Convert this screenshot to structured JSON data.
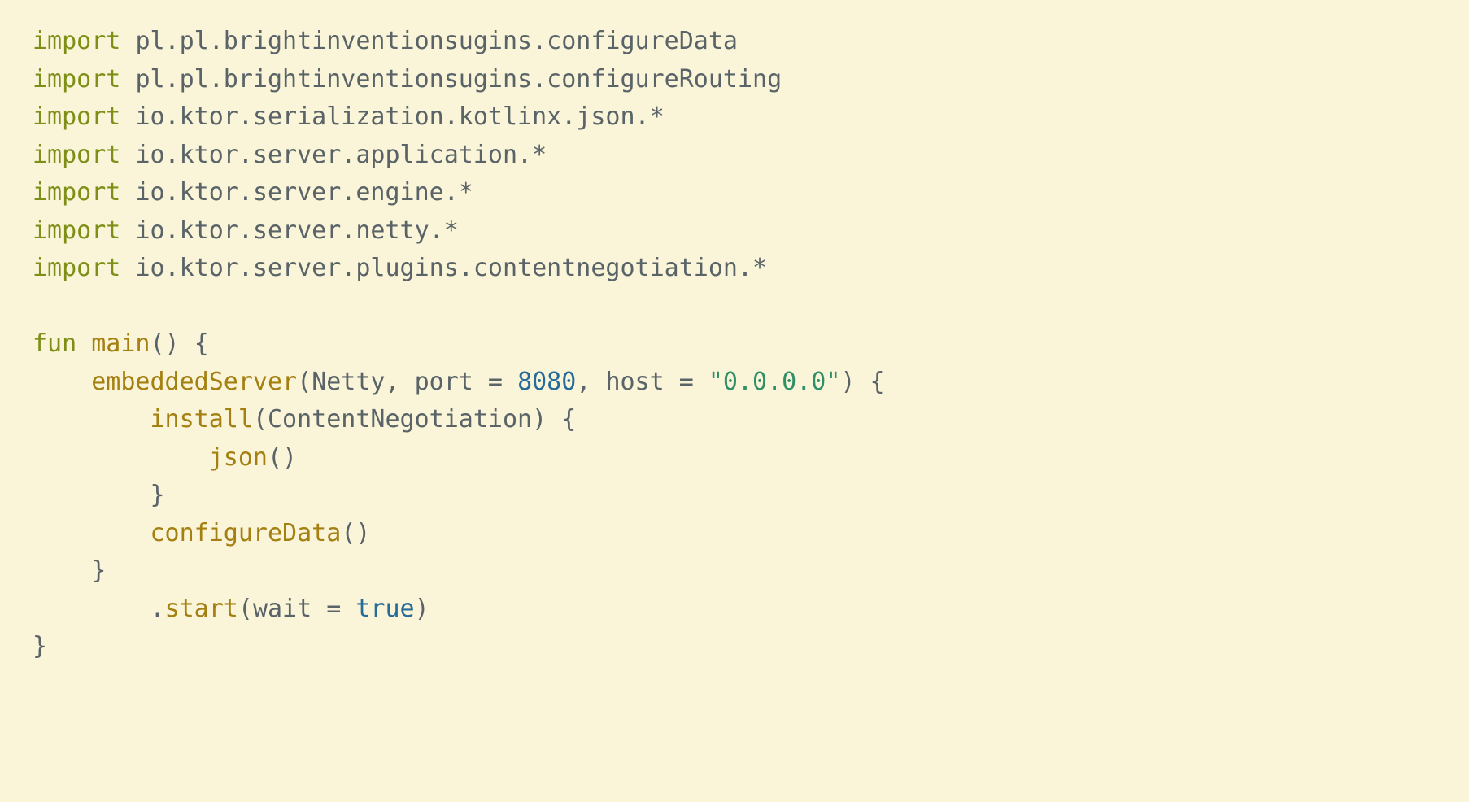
{
  "code": {
    "imports": [
      "pl.pl.brightinventionsugins.configureData",
      "pl.pl.brightinventionsugins.configureRouting",
      "io.ktor.serialization.kotlinx.json.*",
      "io.ktor.server.application.*",
      "io.ktor.server.engine.*",
      "io.ktor.server.netty.*",
      "io.ktor.server.plugins.contentnegotiation.*"
    ],
    "kw_import": "import",
    "kw_fun": "fun",
    "fn_name": "main",
    "call_embeddedServer": "embeddedServer",
    "arg_Netty": "Netty",
    "label_port": "port",
    "val_port": "8080",
    "label_host": "host",
    "val_host": "\"0.0.0.0\"",
    "call_install": "install",
    "arg_ContentNegotiation": "ContentNegotiation",
    "call_json": "json",
    "call_configureData": "configureData",
    "call_start": "start",
    "label_wait": "wait",
    "val_wait": "true"
  }
}
